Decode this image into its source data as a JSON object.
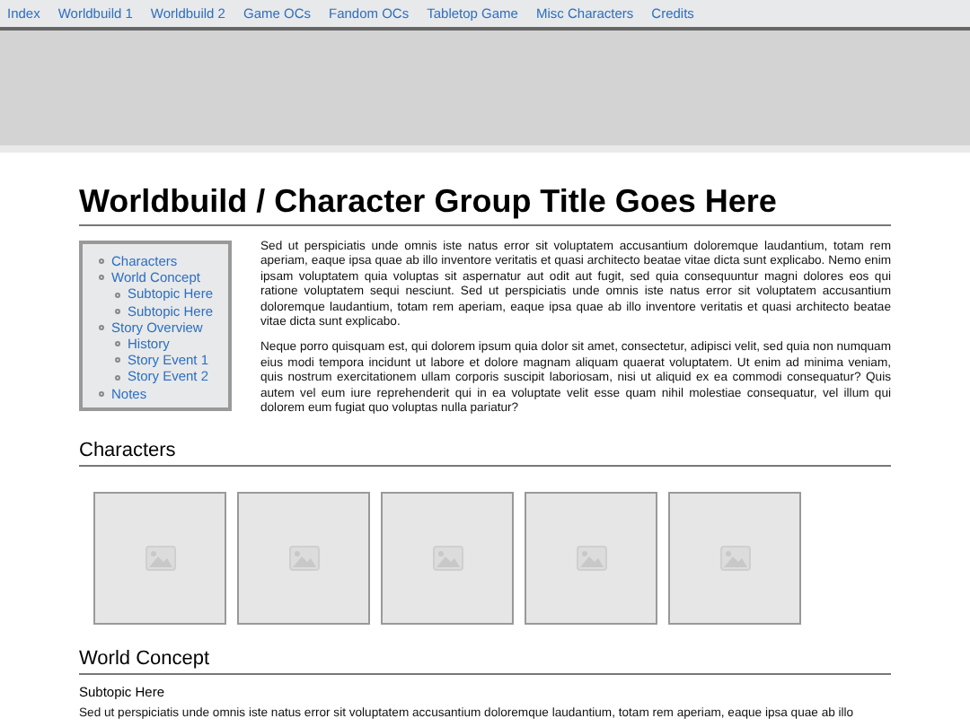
{
  "nav": [
    {
      "label": "Index"
    },
    {
      "label": "Worldbuild 1"
    },
    {
      "label": "Worldbuild 2"
    },
    {
      "label": "Game OCs"
    },
    {
      "label": "Fandom OCs"
    },
    {
      "label": "Tabletop Game"
    },
    {
      "label": "Misc Characters"
    },
    {
      "label": "Credits"
    }
  ],
  "banner": {
    "kind": "picture"
  },
  "title": "Worldbuild / Character Group Title Goes Here",
  "toc": [
    {
      "label": "Characters"
    },
    {
      "label": "World Concept",
      "children": [
        {
          "label": "Subtopic Here"
        },
        {
          "label": "Subtopic Here"
        }
      ]
    },
    {
      "label": "Story Overview",
      "children": [
        {
          "label": "History"
        },
        {
          "label": "Story Event 1"
        },
        {
          "label": "Story Event 2"
        }
      ]
    },
    {
      "label": "Notes"
    }
  ],
  "intro": [
    "Sed ut perspiciatis unde omnis iste natus error sit voluptatem accusantium doloremque laudantium, totam rem aperiam, eaque ipsa quae ab illo inventore veritatis et quasi architecto beatae vitae dicta sunt explicabo. Nemo enim ipsam voluptatem quia voluptas sit aspernatur aut odit aut fugit, sed quia consequuntur magni dolores eos qui ratione voluptatem sequi nesciunt. Sed ut perspiciatis unde omnis iste natus error sit voluptatem accusantium doloremque laudantium, totam rem aperiam, eaque ipsa quae ab illo inventore veritatis et quasi architecto beatae vitae dicta sunt explicabo.",
    "Neque porro quisquam est, qui dolorem ipsum quia dolor sit amet, consectetur, adipisci velit, sed quia non numquam eius modi tempora incidunt ut labore et dolore magnam aliquam quaerat voluptatem. Ut enim ad minima veniam, quis nostrum exercitationem ullam corporis suscipit laboriosam, nisi ut aliquid ex ea commodi consequatur? Quis autem vel eum iure reprehenderit qui in ea voluptate velit esse quam nihil molestiae consequatur, vel illum qui dolorem eum fugiat quo voluptas nulla pariatur?"
  ],
  "characters": {
    "heading": "Characters",
    "images": [
      {
        "kind": "placeholder"
      },
      {
        "kind": "placeholder"
      },
      {
        "kind": "placeholder"
      },
      {
        "kind": "placeholder"
      },
      {
        "kind": "placeholder"
      }
    ]
  },
  "world_concept": {
    "heading": "World Concept",
    "subheading": "Subtopic Here",
    "text": "Sed ut perspiciatis unde omnis iste natus error sit voluptatem accusantium doloremque laudantium, totam rem aperiam, eaque ipsa quae ab illo"
  }
}
